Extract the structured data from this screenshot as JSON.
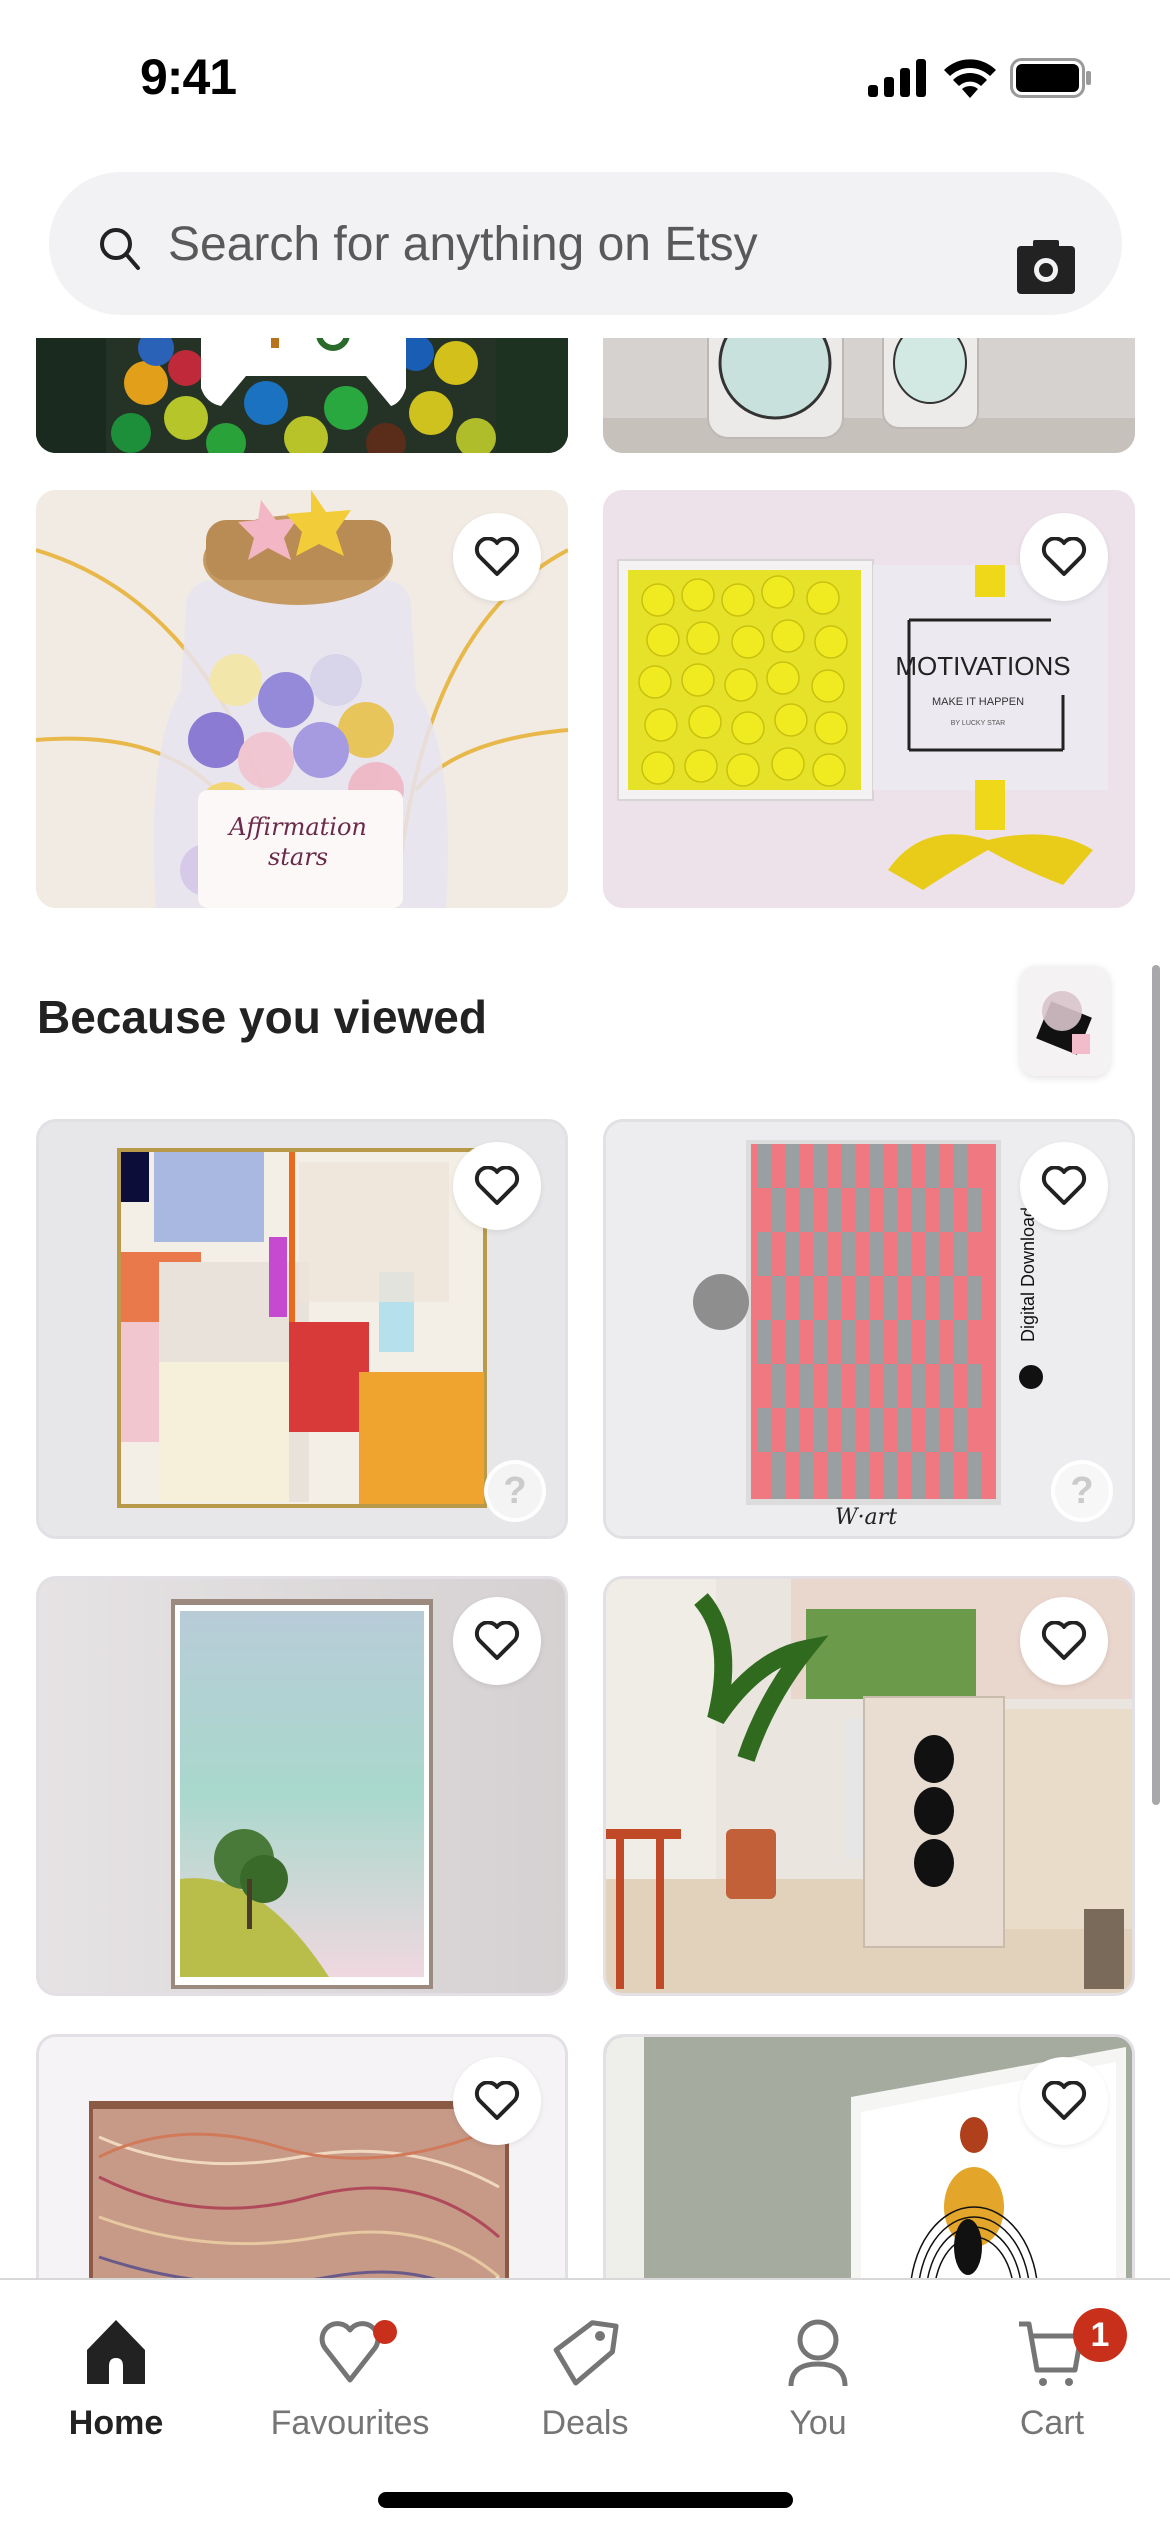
{
  "status_bar": {
    "time": "9:41",
    "icons": [
      "cellular-signal-icon",
      "wifi-icon",
      "battery-icon"
    ]
  },
  "search": {
    "placeholder": "Search for anything on Etsy",
    "value": "",
    "left_icon": "search-icon",
    "right_icon": "camera-icon"
  },
  "top_grid": {
    "items": [
      {
        "description": "Gamepad-shaped jar of colorful candies",
        "favourited": false
      },
      {
        "description": "Affirmations jars with white paper stars",
        "favourited": false
      },
      {
        "description": "Affirmation stars jar with pastel origami stars",
        "image_text": [
          "Affirmation",
          "stars"
        ],
        "favourited": false
      },
      {
        "description": "Box of yellow origami stars with Motivations card",
        "image_text": [
          "MOTIVATIONS",
          "MAKE IT HAPPEN"
        ],
        "favourited": false
      }
    ]
  },
  "because_you_viewed": {
    "title": "Because you viewed",
    "thumbnail": "Abstract geometric art print",
    "items": [
      {
        "description": "Abstract colorful modern art print in gold frame",
        "favourited": false,
        "has_help_button": true
      },
      {
        "description": "Pink and grey checker pattern print",
        "image_text": [
          "Digital Download",
          "W-art"
        ],
        "favourited": false,
        "has_help_button": true
      },
      {
        "description": "Sky with clouds and tree on hill print",
        "favourited": false
      },
      {
        "description": "Three black circles print in living room",
        "favourited": false
      },
      {
        "description": "Abstract dried grass texture print",
        "favourited": false
      },
      {
        "description": "Boho sun arch print in white frame",
        "favourited": false
      }
    ]
  },
  "bottom_nav": {
    "items": [
      {
        "label": "Home",
        "icon": "home-icon",
        "active": true
      },
      {
        "label": "Favourites",
        "icon": "heart-icon",
        "active": false,
        "dot_badge": true
      },
      {
        "label": "Deals",
        "icon": "tag-icon",
        "active": false
      },
      {
        "label": "You",
        "icon": "person-icon",
        "active": false
      },
      {
        "label": "Cart",
        "icon": "cart-icon",
        "active": false,
        "badge_count": "1"
      }
    ]
  },
  "colors": {
    "badge_red": "#c9301c",
    "search_bg": "#f2f1f4",
    "active_text": "#222222",
    "inactive_text": "#757575"
  }
}
